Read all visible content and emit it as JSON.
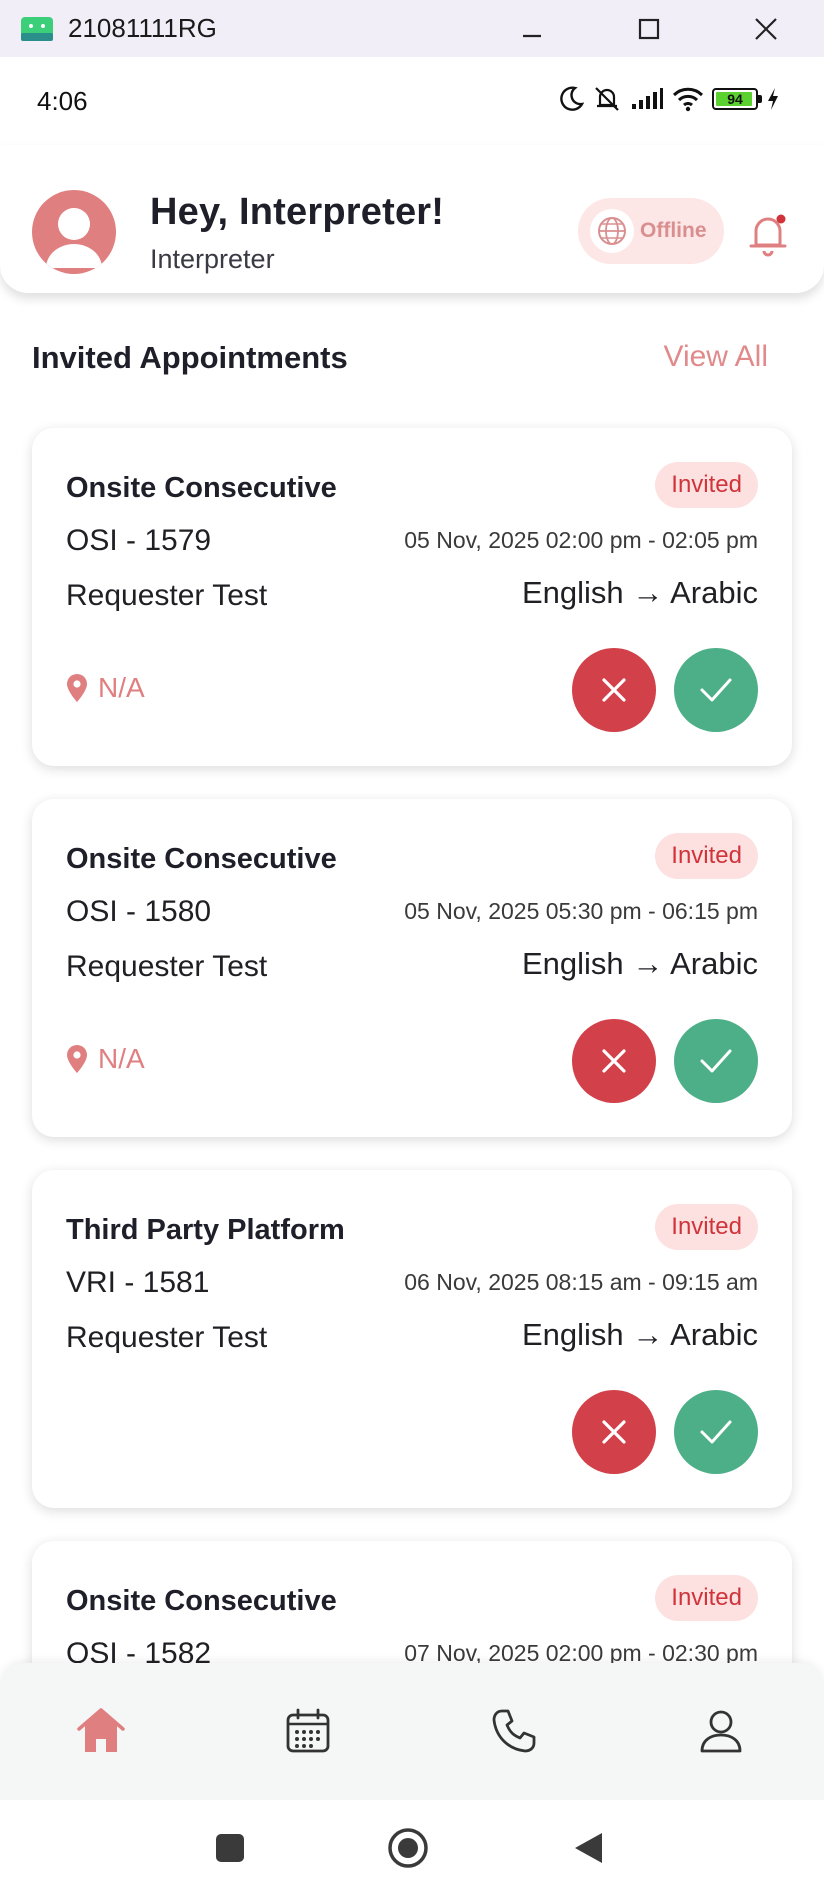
{
  "window": {
    "title": "21081111RG"
  },
  "status_bar": {
    "time": "4:06",
    "battery": "94"
  },
  "header": {
    "greeting": "Hey, Interpreter!",
    "role": "Interpreter",
    "status_label": "Offline"
  },
  "section": {
    "title": "Invited Appointments",
    "view_all": "View All"
  },
  "appointments": [
    {
      "type": "Onsite Consecutive",
      "status": "Invited",
      "code": "OSI - 1579",
      "datetime": "05 Nov, 2025 02:00 pm - 02:05 pm",
      "requester": "Requester Test",
      "languages": "English → Arabic",
      "location": "N/A"
    },
    {
      "type": "Onsite Consecutive",
      "status": "Invited",
      "code": "OSI - 1580",
      "datetime": "05 Nov, 2025 05:30 pm - 06:15 pm",
      "requester": "Requester Test",
      "languages": "English → Arabic",
      "location": "N/A"
    },
    {
      "type": "Third Party Platform",
      "status": "Invited",
      "code": "VRI - 1581",
      "datetime": "06 Nov, 2025 08:15 am - 09:15 am",
      "requester": "Requester Test",
      "languages": "English → Arabic"
    },
    {
      "type": "Onsite Consecutive",
      "status": "Invited",
      "code": "OSI - 1582",
      "datetime": "07 Nov, 2025 02:00 pm - 02:30 pm"
    }
  ],
  "colors": {
    "accent": "#e07f80",
    "reject": "#d2404a",
    "accept": "#4caf88",
    "badge_bg": "#fde1e1",
    "badge_text": "#d0343a"
  },
  "icons": {
    "nav": [
      "home-icon",
      "calendar-icon",
      "phone-icon",
      "profile-icon"
    ],
    "system": [
      "recents-square-icon",
      "home-circle-icon",
      "back-triangle-icon"
    ]
  }
}
